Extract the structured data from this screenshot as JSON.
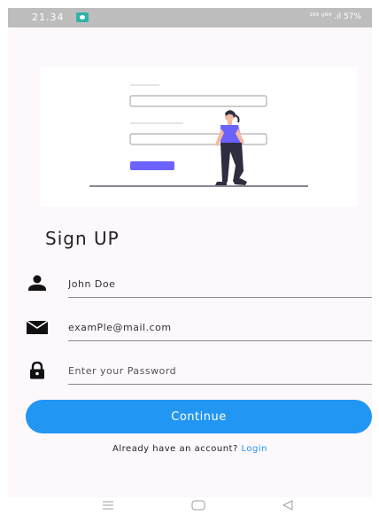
{
  "status_bar": {
    "time": "21.34",
    "indicators": "¹⁶⁹ ᵍᴺ⁴ .ıl 57%"
  },
  "illustration": {
    "icon": "signup-illustration",
    "colors": {
      "accent": "#6c63ff",
      "line": "#3f3d56"
    }
  },
  "page": {
    "title": "Sign UP"
  },
  "form": {
    "name": {
      "icon": "person-icon",
      "value": "John Doe"
    },
    "email": {
      "icon": "envelope-icon",
      "value": "examPle@mail.com"
    },
    "password": {
      "icon": "lock-icon",
      "placeholder": "Enter your Password"
    },
    "continue_label": "Continue"
  },
  "footer": {
    "prompt": "Already have an account? ",
    "login_label": "Login"
  },
  "nav": {
    "icons": [
      "menu-icon",
      "home-icon",
      "back-icon"
    ]
  },
  "colors": {
    "primary": "#2196f3",
    "background": "#fcf8fc",
    "status_bar": "#bdbdbd"
  }
}
